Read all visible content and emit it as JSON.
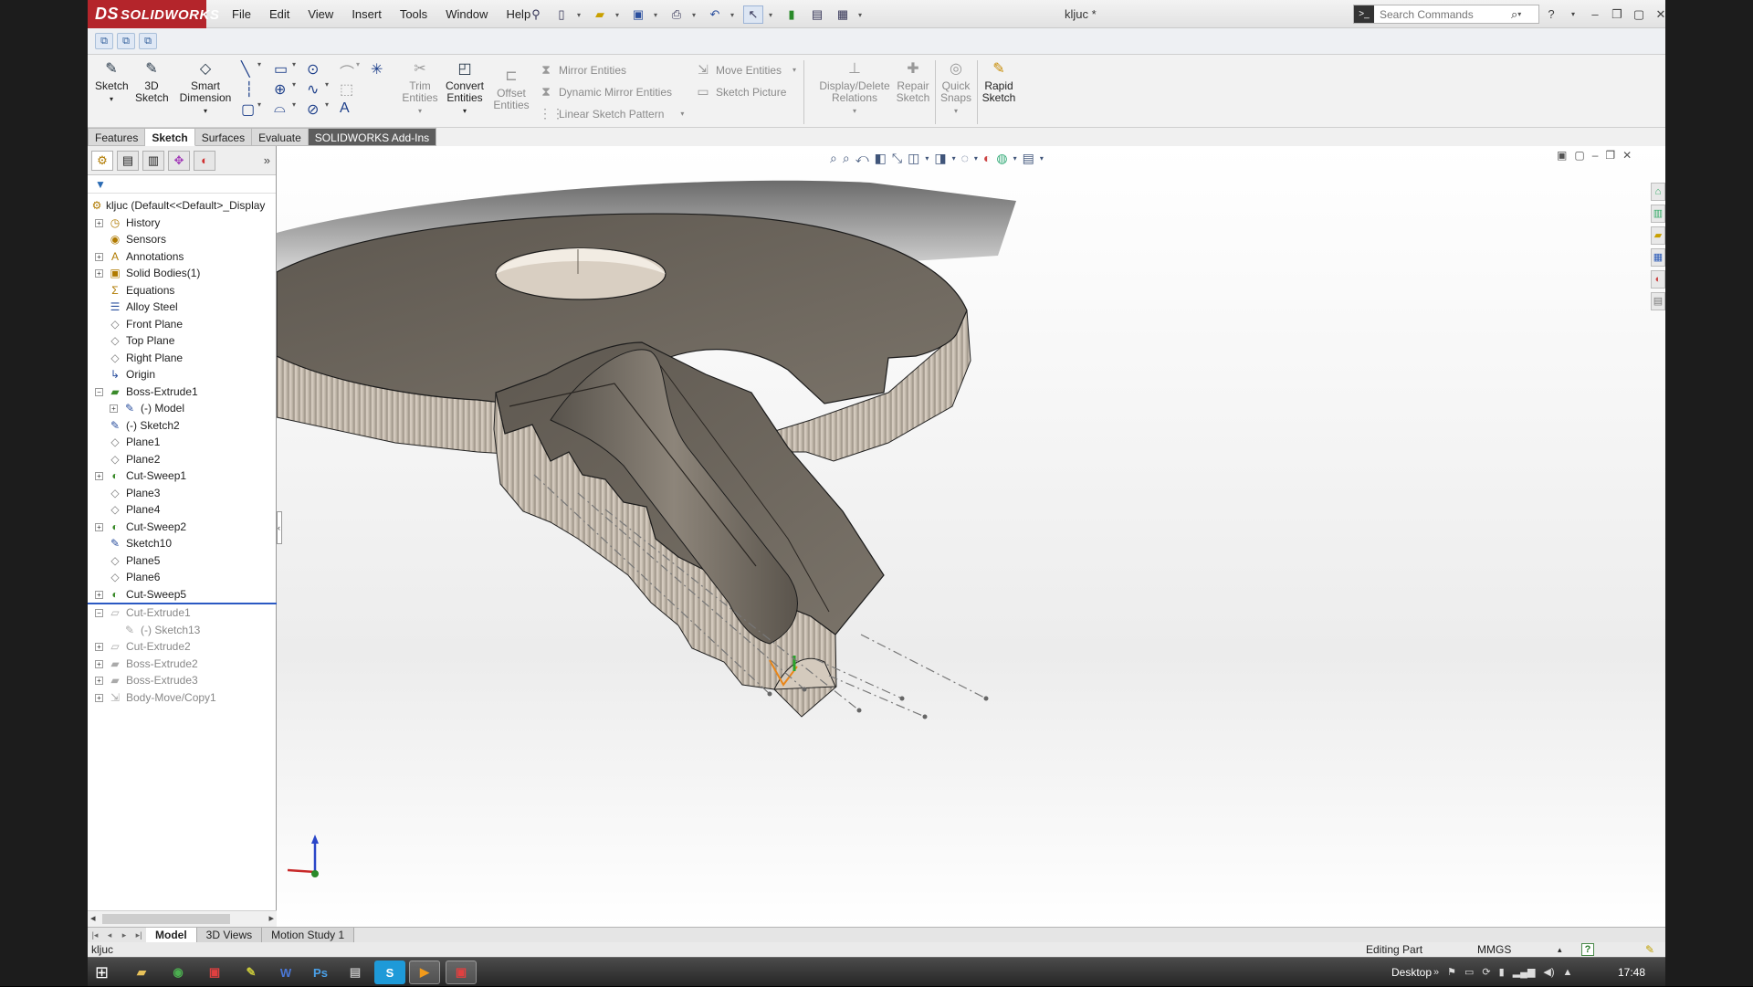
{
  "app": {
    "logo_text": "SOLIDWORKS",
    "logo_mark": "DS",
    "document_title": "kljuc *"
  },
  "menu": [
    "File",
    "Edit",
    "View",
    "Insert",
    "Tools",
    "Window",
    "Help"
  ],
  "search": {
    "placeholder": "Search Commands"
  },
  "commands": {
    "sketch": "Sketch",
    "sketch3d_1": "3D",
    "sketch3d_2": "Sketch",
    "smart_dim_1": "Smart",
    "smart_dim_2": "Dimension",
    "trim_1": "Trim",
    "trim_2": "Entities",
    "convert_1": "Convert",
    "convert_2": "Entities",
    "offset_1": "Offset",
    "offset_2": "Entities",
    "mirror": "Mirror Entities",
    "dynamic_mirror": "Dynamic Mirror Entities",
    "linear_pattern": "Linear Sketch Pattern",
    "move": "Move Entities",
    "sketch_picture": "Sketch Picture",
    "display_delete_1": "Display/Delete",
    "display_delete_2": "Relations",
    "repair_1": "Repair",
    "repair_2": "Sketch",
    "quick_snaps_1": "Quick",
    "quick_snaps_2": "Snaps",
    "rapid_1": "Rapid",
    "rapid_2": "Sketch"
  },
  "tabs": [
    "Features",
    "Sketch",
    "Surfaces",
    "Evaluate",
    "SOLIDWORKS Add-Ins"
  ],
  "active_tab": "Sketch",
  "tree": {
    "root": "kljuc  (Default<<Default>_Display",
    "items": [
      {
        "label": "History",
        "level": 1,
        "expand": true,
        "icon": "history-icon"
      },
      {
        "label": "Sensors",
        "level": 1,
        "expand": false,
        "icon": "sensors-icon"
      },
      {
        "label": "Annotations",
        "level": 1,
        "expand": true,
        "icon": "annotations-icon"
      },
      {
        "label": "Solid Bodies(1)",
        "level": 1,
        "expand": true,
        "icon": "solid-bodies-icon"
      },
      {
        "label": "Equations",
        "level": 1,
        "expand": false,
        "icon": "equations-icon"
      },
      {
        "label": "Alloy Steel",
        "level": 1,
        "expand": false,
        "icon": "material-icon"
      },
      {
        "label": "Front Plane",
        "level": 1,
        "expand": false,
        "icon": "plane-icon"
      },
      {
        "label": "Top Plane",
        "level": 1,
        "expand": false,
        "icon": "plane-icon"
      },
      {
        "label": "Right Plane",
        "level": 1,
        "expand": false,
        "icon": "plane-icon"
      },
      {
        "label": "Origin",
        "level": 1,
        "expand": false,
        "icon": "origin-icon"
      },
      {
        "label": "Boss-Extrude1",
        "level": 1,
        "expand": true,
        "open": true,
        "icon": "extrude-icon"
      },
      {
        "label": "(-) Model",
        "level": 2,
        "expand": true,
        "icon": "sketch-icon"
      },
      {
        "label": "(-) Sketch2",
        "level": 1,
        "expand": false,
        "icon": "sketch-icon"
      },
      {
        "label": "Plane1",
        "level": 1,
        "expand": false,
        "icon": "plane-icon"
      },
      {
        "label": "Plane2",
        "level": 1,
        "expand": false,
        "icon": "plane-icon"
      },
      {
        "label": "Cut-Sweep1",
        "level": 1,
        "expand": true,
        "icon": "sweep-icon"
      },
      {
        "label": "Plane3",
        "level": 1,
        "expand": false,
        "icon": "plane-icon"
      },
      {
        "label": "Plane4",
        "level": 1,
        "expand": false,
        "icon": "plane-icon"
      },
      {
        "label": "Cut-Sweep2",
        "level": 1,
        "expand": true,
        "icon": "sweep-icon"
      },
      {
        "label": "Sketch10",
        "level": 1,
        "expand": false,
        "icon": "sketch-icon"
      },
      {
        "label": "Plane5",
        "level": 1,
        "expand": false,
        "icon": "plane-icon"
      },
      {
        "label": "Plane6",
        "level": 1,
        "expand": false,
        "icon": "plane-icon"
      },
      {
        "label": "Cut-Sweep5",
        "level": 1,
        "expand": true,
        "icon": "sweep-icon"
      },
      {
        "label": "Cut-Extrude1",
        "level": 1,
        "expand": true,
        "open": true,
        "suppressed": true,
        "icon": "cut-extrude-icon"
      },
      {
        "label": "(-) Sketch13",
        "level": 2,
        "expand": false,
        "suppressed": true,
        "icon": "sketch-icon"
      },
      {
        "label": "Cut-Extrude2",
        "level": 1,
        "expand": true,
        "suppressed": true,
        "icon": "cut-extrude-icon"
      },
      {
        "label": "Boss-Extrude2",
        "level": 1,
        "expand": true,
        "suppressed": true,
        "icon": "extrude-icon"
      },
      {
        "label": "Boss-Extrude3",
        "level": 1,
        "expand": true,
        "suppressed": true,
        "icon": "extrude-icon"
      },
      {
        "label": "Body-Move/Copy1",
        "level": 1,
        "expand": true,
        "suppressed": true,
        "icon": "move-copy-icon"
      }
    ]
  },
  "bottom_tabs": [
    "Model",
    "3D Views",
    "Motion Study 1"
  ],
  "active_bottom_tab": "Model",
  "status": {
    "left": "kljuc",
    "editing": "Editing Part",
    "units": "MMGS",
    "help": "?"
  },
  "taskbar": {
    "desktop": "Desktop",
    "clock": "17:48",
    "apps": [
      "file-explorer",
      "chrome",
      "solidworks-installer",
      "pen-app",
      "word",
      "photoshop",
      "network",
      "skype",
      "media-player",
      "solidworks"
    ]
  },
  "colors": {
    "brand": "#b4252b",
    "model_top": "#6b655c",
    "model_side": "#c9c0b4",
    "rollback": "#2b59c3"
  }
}
